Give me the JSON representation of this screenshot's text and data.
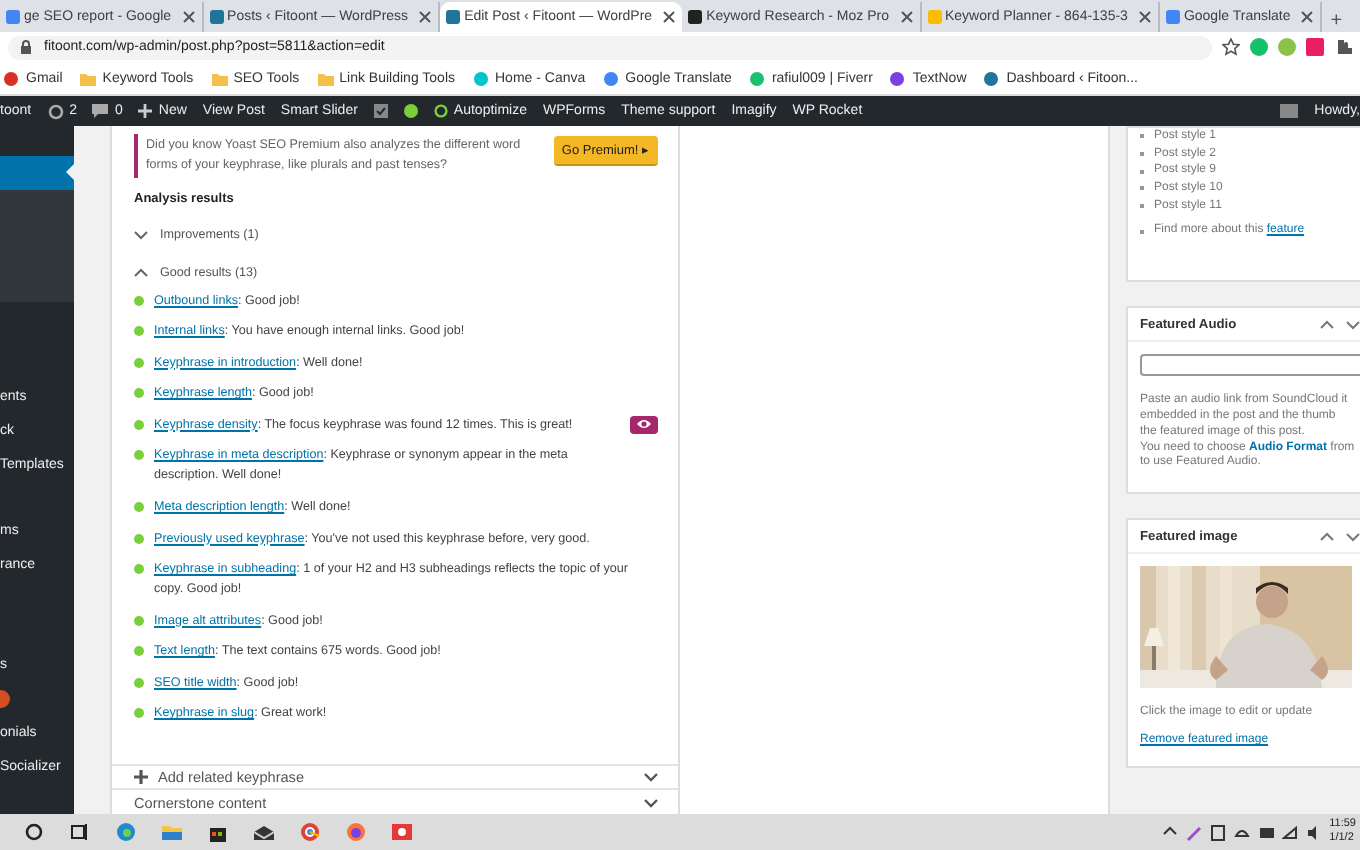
{
  "browser": {
    "tabs": [
      {
        "title": "ge SEO report - Google",
        "selected": false
      },
      {
        "title": "Posts ‹ Fitoont — WordPress",
        "selected": false
      },
      {
        "title": "Edit Post ‹ Fitoont — WordPre",
        "selected": true
      },
      {
        "title": "Keyword Research - Moz Pro",
        "selected": false
      },
      {
        "title": "Keyword Planner - 864-135-3",
        "selected": false
      },
      {
        "title": "Google Translate",
        "selected": false
      }
    ],
    "new_tab": "+",
    "url": "fitoont.com/wp-admin/post.php?post=5811&action=edit",
    "bookmarks": [
      "Gmail",
      "Keyword Tools",
      "SEO Tools",
      "Link Building Tools",
      "Home - Canva",
      "Google Translate",
      "rafiul009 | Fiverr",
      "TextNow",
      "Dashboard ‹ Fitoon..."
    ]
  },
  "admin_bar": {
    "site": "toont",
    "updates": "2",
    "comments": "0",
    "items": [
      "New",
      "View Post",
      "Smart Slider",
      "Autoptimize",
      "WPForms",
      "Theme support",
      "Imagify",
      "WP Rocket"
    ],
    "greeting": "Howdy,"
  },
  "sidebar": {
    "items": [
      {
        "kind": "item",
        "selected": true
      },
      {
        "kind": "item",
        "label": "ents",
        "selected": false
      },
      {
        "kind": "item",
        "label": "ck",
        "selected": false
      },
      {
        "kind": "item",
        "label": "Templates",
        "selected": false
      },
      {
        "kind": "item",
        "label": "ms",
        "selected": false
      },
      {
        "kind": "item",
        "label": "rance",
        "selected": false
      },
      {
        "kind": "item",
        "label": "s",
        "selected": false
      },
      {
        "kind": "badge",
        "selected": false
      },
      {
        "kind": "item",
        "label": "onials",
        "selected": false
      },
      {
        "kind": "item",
        "label": "Socializer",
        "selected": false
      }
    ]
  },
  "seo": {
    "notice": "Did you know Yoast SEO Premium also analyzes the different word forms of your keyphrase, like plurals and past tenses?",
    "premium_button": "Go Premium! ▸",
    "heading": "Analysis results",
    "groups": [
      {
        "label": "Improvements (1)",
        "expanded": false
      },
      {
        "label": "Good results (13)",
        "expanded": true
      }
    ],
    "results": [
      {
        "link": "Outbound links",
        "text": ": Good job!",
        "color": "#7ad03a"
      },
      {
        "link": "Internal links",
        "text": ": You have enough internal links. Good job!",
        "color": "#7ad03a"
      },
      {
        "link": "Keyphrase in introduction",
        "text": ": Well done!",
        "color": "#7ad03a"
      },
      {
        "link": "Keyphrase length",
        "text": ": Good job!",
        "color": "#7ad03a"
      },
      {
        "link": "Keyphrase density",
        "text": ": The focus keyphrase was found 12 times. This is great!",
        "color": "#7ad03a",
        "highlight": true
      },
      {
        "link": "Keyphrase in meta description",
        "text": ": Keyphrase or synonym appear in the meta description. Well done!",
        "color": "#7ad03a"
      },
      {
        "link": "Meta description length",
        "text": ": Well done!",
        "color": "#7ad03a"
      },
      {
        "link": "Previously used keyphrase",
        "text": ": You've not used this keyphrase before, very good.",
        "color": "#7ad03a"
      },
      {
        "link": "Keyphrase in subheading",
        "text": ": 1 of your H2 and H3 subheadings reflects the topic of your copy. Good job!",
        "color": "#7ad03a"
      },
      {
        "link": "Image alt attributes",
        "text": ": Good job!",
        "color": "#7ad03a"
      },
      {
        "link": "Text length",
        "text": ": The text contains 675 words. Good job!",
        "color": "#7ad03a"
      },
      {
        "link": "SEO title width",
        "text": ": Good job!",
        "color": "#7ad03a"
      },
      {
        "link": "Keyphrase in slug",
        "text": ": Great work!",
        "color": "#7ad03a"
      }
    ],
    "panels": [
      {
        "kind": "add",
        "label": "Add related keyphrase"
      },
      {
        "kind": "plain",
        "label": "Cornerstone content"
      }
    ]
  },
  "right": {
    "post_styles": [
      "Post style 1",
      "Post style 2",
      "Post style 9",
      "Post style 10",
      "Post style 11"
    ],
    "more_text": "Find more about this ",
    "more_link": "feature",
    "audio": {
      "title": "Featured Audio",
      "lines": [
        "Paste an audio link from SoundCloud it",
        "embedded in the post and the thumb",
        "the featured image of this post."
      ],
      "choose_text": "You need to choose ",
      "choose_link": "Audio Format",
      "choose_rest": " from",
      "last_line": "to use Featured Audio."
    },
    "image": {
      "title": "Featured image",
      "hint": "Click the image to edit or update",
      "remove": "Remove featured image"
    }
  },
  "taskbar": {
    "time": "11:59",
    "date": "1/1/2"
  }
}
